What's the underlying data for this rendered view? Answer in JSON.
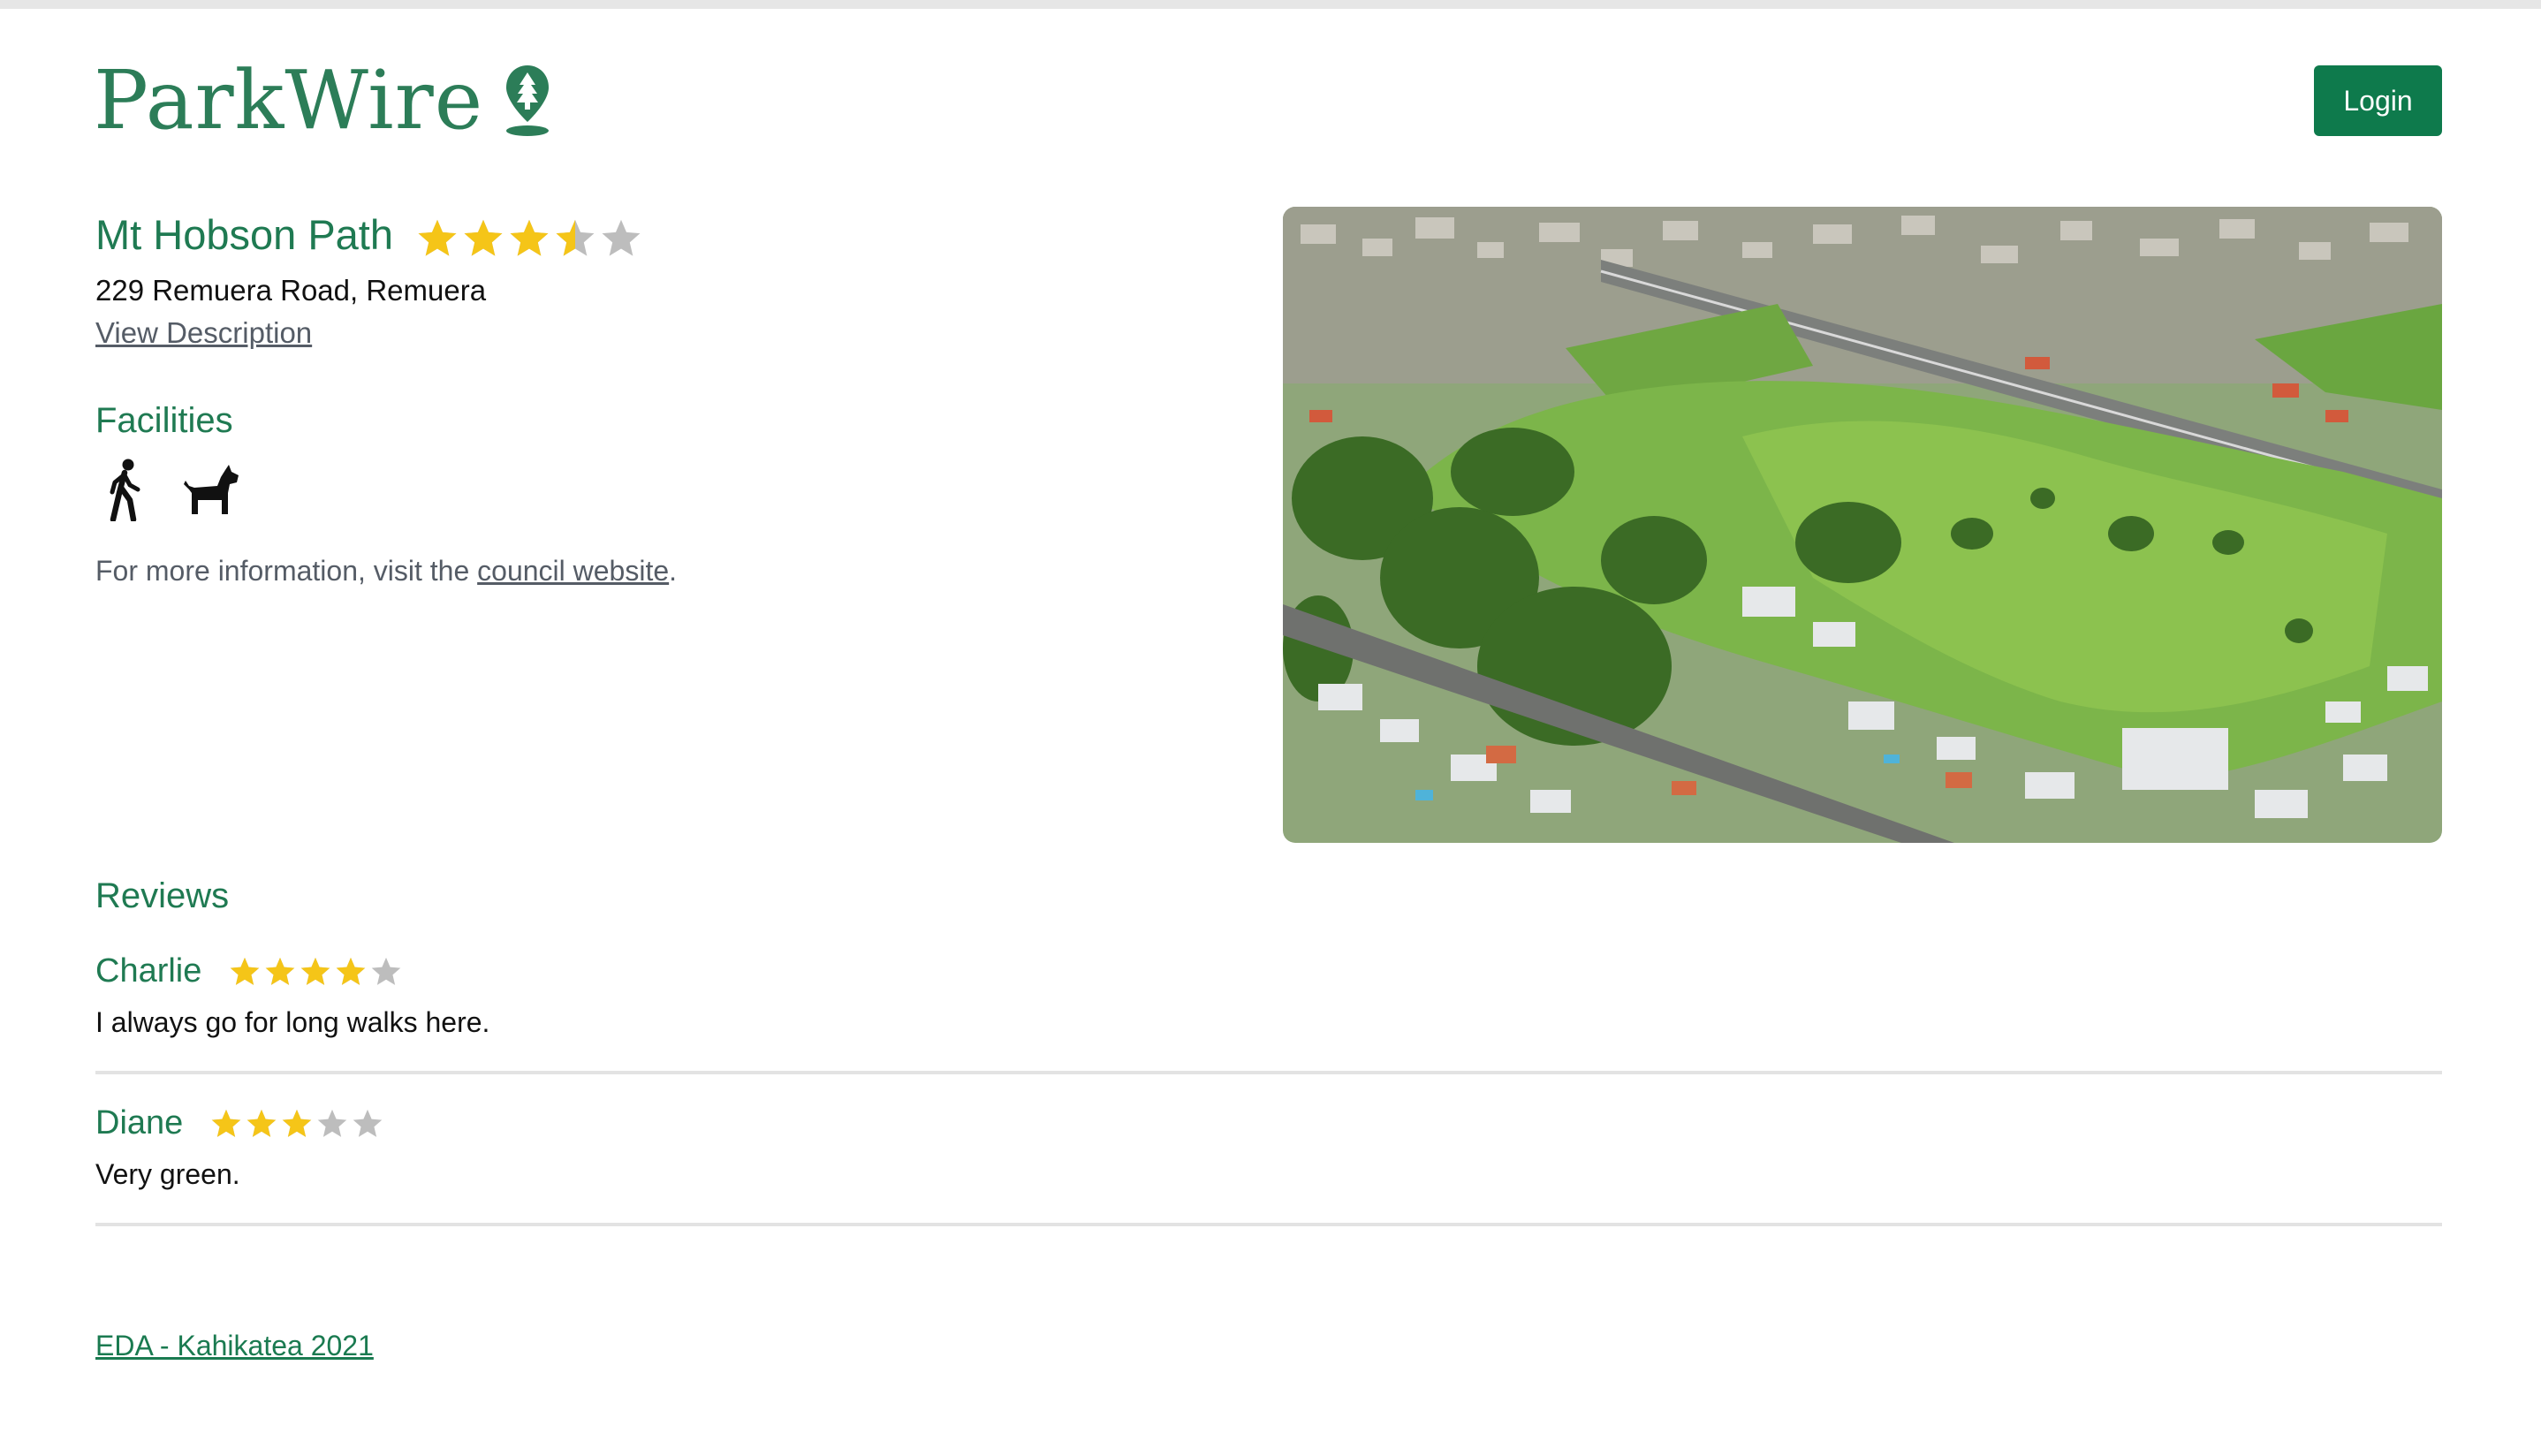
{
  "brand": {
    "name": "ParkWire",
    "icon": "tree-pin-icon",
    "color": "#2c7d58"
  },
  "header": {
    "login_label": "Login",
    "button_color": "#0e7a4c"
  },
  "park": {
    "name": "Mt Hobson Path",
    "rating": 3.5,
    "max_rating": 5,
    "address": "229 Remuera Road, Remuera",
    "description_link": "View Description",
    "photo": "aerial-park-photo"
  },
  "facilities": {
    "heading": "Facilities",
    "items": [
      {
        "icon": "walking-icon"
      },
      {
        "icon": "dog-icon"
      }
    ],
    "info_prefix": "For more information, visit the ",
    "info_link": "council website",
    "info_suffix": "."
  },
  "reviews": {
    "heading": "Reviews",
    "items": [
      {
        "author": "Charlie",
        "rating": 4,
        "text": "I always go for long walks here."
      },
      {
        "author": "Diane",
        "rating": 3,
        "text": "Very green."
      }
    ]
  },
  "footer": {
    "link": "EDA - Kahikatea 2021"
  },
  "colors": {
    "star_filled": "#f5c518",
    "star_empty": "#bdbdbd",
    "accent": "#1f7a52"
  }
}
